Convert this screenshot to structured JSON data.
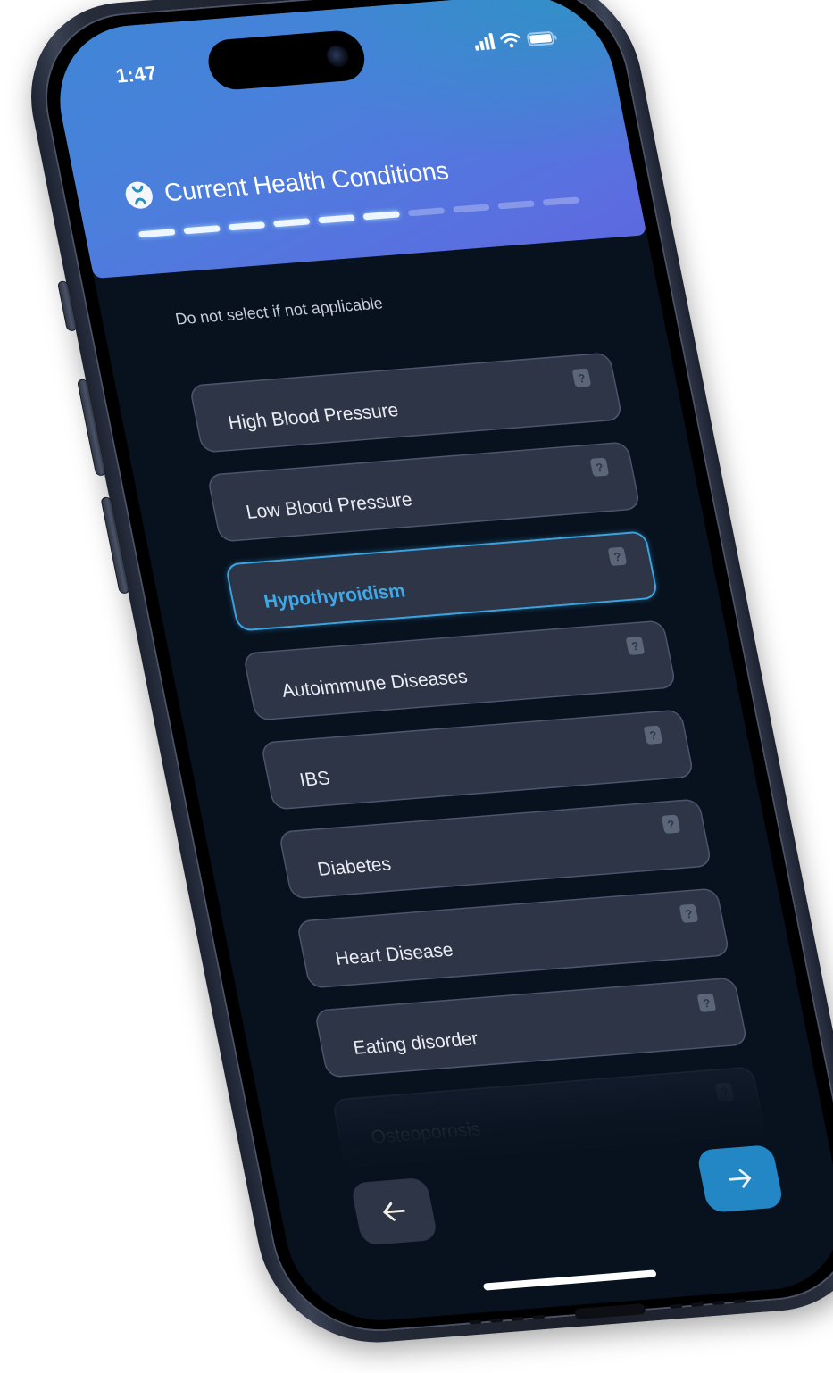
{
  "status_bar": {
    "time": "1:47",
    "icons": [
      "cellular-signal-icon",
      "wifi-icon",
      "battery-icon"
    ]
  },
  "header": {
    "logo_icon": "chromosome-icon",
    "title": "Current Health Conditions",
    "progress": {
      "total_steps": 10,
      "completed_steps": 6
    }
  },
  "subtitle": "Do not select if not applicable",
  "conditions": [
    {
      "label": "High Blood Pressure",
      "selected": false,
      "help_icon": "?"
    },
    {
      "label": "Low Blood Pressure",
      "selected": false,
      "help_icon": "?"
    },
    {
      "label": "Hypothyroidism",
      "selected": true,
      "help_icon": "?"
    },
    {
      "label": "Autoimmune Diseases",
      "selected": false,
      "help_icon": "?"
    },
    {
      "label": "IBS",
      "selected": false,
      "help_icon": "?"
    },
    {
      "label": "Diabetes",
      "selected": false,
      "help_icon": "?"
    },
    {
      "label": "Heart Disease",
      "selected": false,
      "help_icon": "?"
    },
    {
      "label": "Eating disorder",
      "selected": false,
      "help_icon": "?"
    },
    {
      "label": "Osteoporosis",
      "selected": false,
      "help_icon": "?"
    }
  ],
  "navigation": {
    "back_icon": "arrow-left-icon",
    "next_icon": "arrow-right-icon"
  },
  "colors": {
    "accent": "#2487c5",
    "selected_text": "#41a8e6",
    "screen_bg": "#08121f",
    "card_bg": "#2d3547",
    "header_gradient_start": "#3f86d6",
    "header_gradient_end": "#5d69df"
  }
}
